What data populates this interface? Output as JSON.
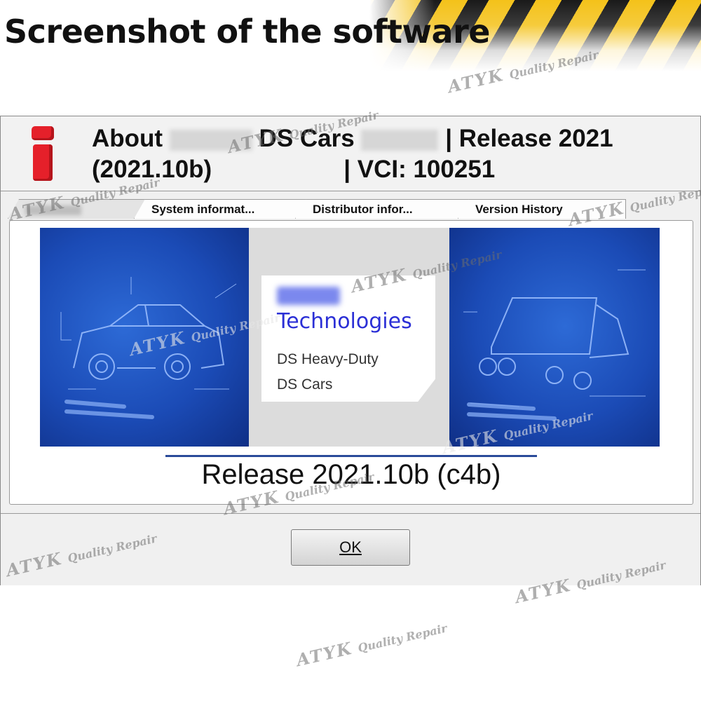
{
  "banner": {
    "title": "Screenshot of the software"
  },
  "dialog": {
    "header": {
      "title_prefix": "About",
      "product": "DS Cars",
      "release_label": "| Release 2021",
      "version_paren": "(2021.10b)",
      "vci_label": "|  VCI: 100251"
    },
    "tabs": [
      {
        "label": ""
      },
      {
        "label": "System  informat..."
      },
      {
        "label": "Distributor  infor..."
      },
      {
        "label": "Version History"
      }
    ],
    "card": {
      "brand_name": "Technologies",
      "line1": "DS Heavy-Duty",
      "line2": "DS Cars"
    },
    "release_text": "Release 2021.10b (c4b)",
    "ok_label": "OK"
  },
  "watermark": {
    "brand": "ATYK",
    "tagline": "Quality Repair"
  },
  "colors": {
    "icon_red": "#e5202a",
    "brand_blue": "#2b2fd6",
    "panel_blue": "#1b4bb6",
    "stripe_yellow": "#f4c21a"
  },
  "icons": {
    "header_icon": "info-icon"
  }
}
